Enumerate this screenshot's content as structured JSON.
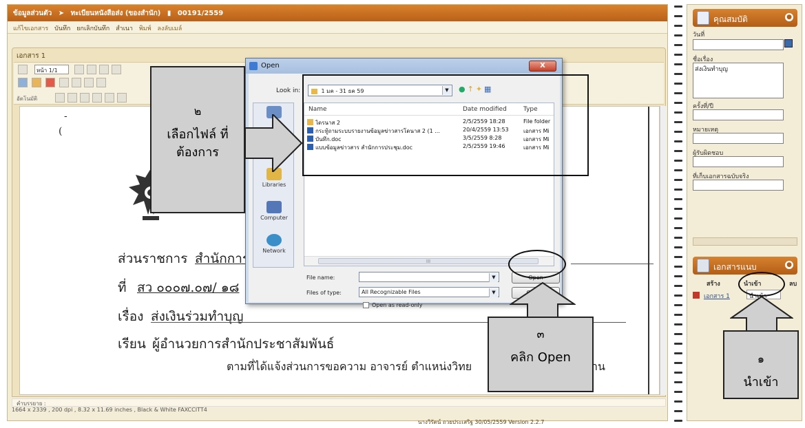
{
  "app": {
    "title_parts": [
      "ข้อมูลส่วนตัว",
      "ทะเบียนหนังสือส่ง (ของสำนัก)",
      "00191/2559"
    ],
    "menu": [
      "แก้ไขเอกสาร",
      "บันทึก",
      "ยกเลิกบันทึก",
      "สำเนา",
      "พิมพ์",
      "ลงลับเมล์"
    ],
    "doc_tab": "เอกสาร 1",
    "page_select": "หน้า 1/1",
    "toolbar3_label": "อัตโนมัติ",
    "paper": {
      "agency_label": "ส่วนราชการ",
      "agency_value": "สำนักการเ",
      "ref_label": "ที่",
      "ref_value": "สว ๐๐๐๗.๐๗/ ๑๘",
      "subject_label": "เรื่อง",
      "subject_value": "ส่งเงินร่วมทำบุญ",
      "to_label": "เรียน",
      "to_value": "ผู้อำนวยการสำนักประชาสัมพันธ์",
      "body_fragment_1": "ตามที่ได้แจ้งส่วนการขอความ อาจารย์ ตำแหน่งวิทย",
      "body_fragment_2": "าน",
      "mark_left": "(",
      "mark_right": "-"
    },
    "status_line1": "คำบรรยาย :",
    "status_line2": "1664 x 2339 , 200 dpi , 8.32 x 11.69 inches , Black & White FAXCCITT4",
    "status_line3": "นางวิรัตน์ ถวยประเสริฐ 30/05/2559   Version 2.2.7"
  },
  "side": {
    "props_title": "คุณสมบัติ",
    "date_label": "วันที่",
    "subject_label": "ชื่อเรื่อง",
    "subject_value": "ส่งเงินทำบุญ",
    "times_label": "ครั้งที่/ปี",
    "note_label": "หมายเหตุ",
    "owner_label": "ผู้รับผิดชอบ",
    "storage_label": "ที่เก็บเอกสารฉบับจริง",
    "attach_title": "เอกสารแนบ",
    "attach_cols": [
      "สร้าง",
      "นำเข้า",
      "ลบ"
    ],
    "attach_item": "เอกสาร 1",
    "attach_import": "นำเข้า"
  },
  "dialog": {
    "title": "Open",
    "close": "X",
    "lookin_label": "Look in:",
    "lookin_value": "1 มค - 31 ธค 59",
    "places": [
      "Recent Places",
      "Desktop",
      "Libraries",
      "Computer",
      "Network"
    ],
    "columns": [
      "Name",
      "Date modified",
      "Type"
    ],
    "files": [
      {
        "name": "ไดรนาส 2",
        "date": "2/5/2559 18:28",
        "type": "File folder",
        "kind": "folder"
      },
      {
        "name": "กระทู้ถามระบบรายงานข้อมูลข่าวสารโดนาส 2 (1 ...",
        "date": "20/4/2559 13:53",
        "type": "เอกสาร Mi",
        "kind": "doc"
      },
      {
        "name": "บันทึก.doc",
        "date": "3/5/2559 8:28",
        "type": "เอกสาร Mi",
        "kind": "doc"
      },
      {
        "name": "แบบข้อมูลข่าวสาร สำนักการประชุม.doc",
        "date": "2/5/2559 19:46",
        "type": "เอกสาร Mi",
        "kind": "doc"
      }
    ],
    "scroll_glyph": "III",
    "filename_label": "File name:",
    "filename_value": "",
    "filetype_label": "Files of type:",
    "filetype_value": "All Recognizable Files",
    "readonly_label": "Open as read-only",
    "open_button": "Open",
    "cancel_button": "Cancel"
  },
  "callouts": {
    "step2_num": "๒",
    "step2_text": "เลือกไฟล์ ที่ต้องการ",
    "step3_num": "๓",
    "step3_text": "คลิก Open",
    "step1_num": "๑",
    "step1_text": "นำเข้า"
  },
  "colors": {
    "orange_header": "#c46a20",
    "panel_bg": "#f3ecd7",
    "dialog_frame": "#cfdcec",
    "callout_gray": "#d0d0d0"
  }
}
